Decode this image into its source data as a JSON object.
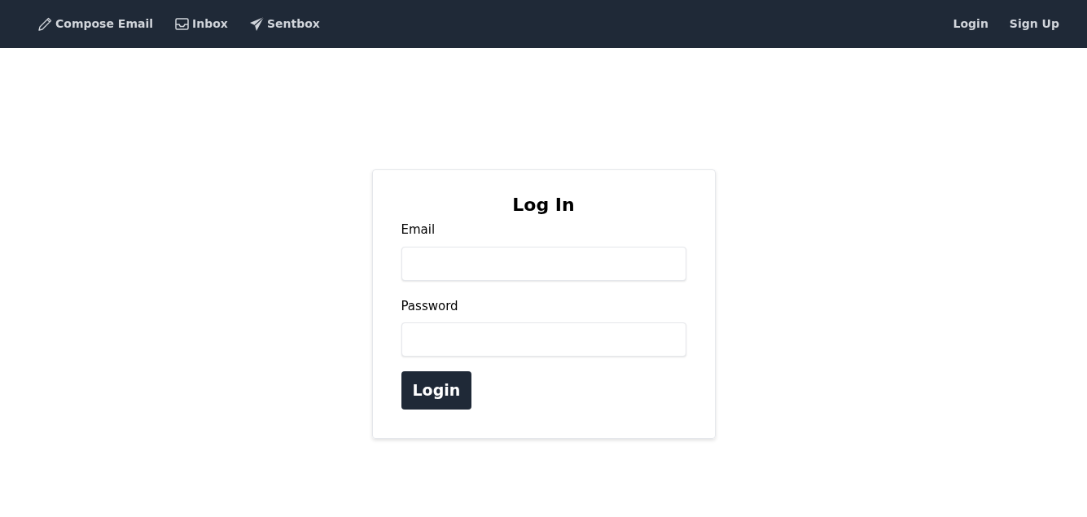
{
  "navbar": {
    "left_items": [
      {
        "kind": "compose",
        "label": "Compose Email"
      },
      {
        "kind": "inbox",
        "label": "Inbox"
      },
      {
        "kind": "sent",
        "label": "Sentbox"
      }
    ],
    "right_items": [
      {
        "label": "Login"
      },
      {
        "label": "Sign Up"
      }
    ]
  },
  "login_form": {
    "title": "Log In",
    "fields": [
      {
        "label": "Email"
      },
      {
        "label": "Password"
      }
    ],
    "submit": "Login"
  }
}
